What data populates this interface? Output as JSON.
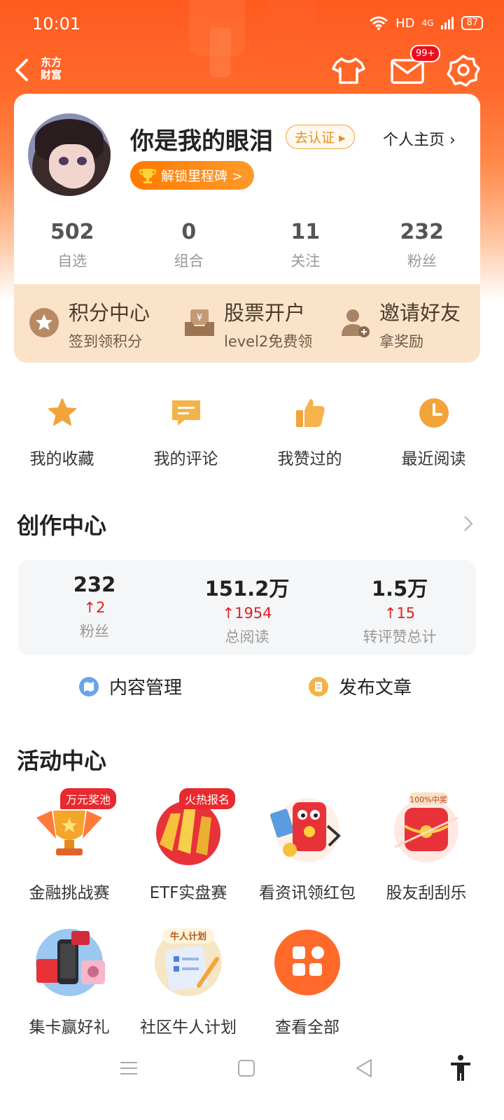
{
  "status_bar": {
    "time": "10:01",
    "network": "HD",
    "signal": "4G",
    "battery": "87"
  },
  "header": {
    "brand_line1": "东方",
    "brand_line2": "财富",
    "mail_badge": "99+"
  },
  "profile": {
    "username": "你是我的眼泪",
    "verify_label": "去认证 ▸",
    "homepage_label": "个人主页",
    "milestone_label": "解锁里程碑 >",
    "stats": [
      {
        "value": "502",
        "label": "自选"
      },
      {
        "value": "0",
        "label": "组合"
      },
      {
        "value": "11",
        "label": "关注"
      },
      {
        "value": "232",
        "label": "粉丝"
      }
    ]
  },
  "promo": [
    {
      "title": "积分中心",
      "sub": "签到领积分"
    },
    {
      "title": "股票开户",
      "sub": "level2免费领"
    },
    {
      "title": "邀请好友",
      "sub": "拿奖励"
    }
  ],
  "shortcuts": [
    {
      "label": "我的收藏"
    },
    {
      "label": "我的评论"
    },
    {
      "label": "我赞过的"
    },
    {
      "label": "最近阅读"
    }
  ],
  "creation": {
    "title": "创作中心",
    "stats": [
      {
        "value": "232",
        "delta": "2",
        "label": "粉丝"
      },
      {
        "value": "151.2万",
        "delta": "1954",
        "label": "总阅读"
      },
      {
        "value": "1.5万",
        "delta": "15",
        "label": "转评赞总计"
      }
    ],
    "actions": [
      {
        "label": "内容管理"
      },
      {
        "label": "发布文章"
      }
    ]
  },
  "activities": {
    "title": "活动中心",
    "items": [
      {
        "label": "金融挑战赛",
        "tag": "万元奖池"
      },
      {
        "label": "ETF实盘赛",
        "tag": "火热报名"
      },
      {
        "label": "看资讯领红包",
        "tag": ""
      },
      {
        "label": "股友刮刮乐",
        "tag": ""
      },
      {
        "label": "集卡赢好礼",
        "tag": ""
      },
      {
        "label": "社区牛人计划",
        "tag": ""
      },
      {
        "label": "查看全部",
        "tag": ""
      }
    ],
    "badge_100": "100%中奖",
    "plan_badge": "牛人计划"
  },
  "colors": {
    "accent": "#ff5a1f",
    "gold": "#f2a33a",
    "up_red": "#e02020"
  }
}
